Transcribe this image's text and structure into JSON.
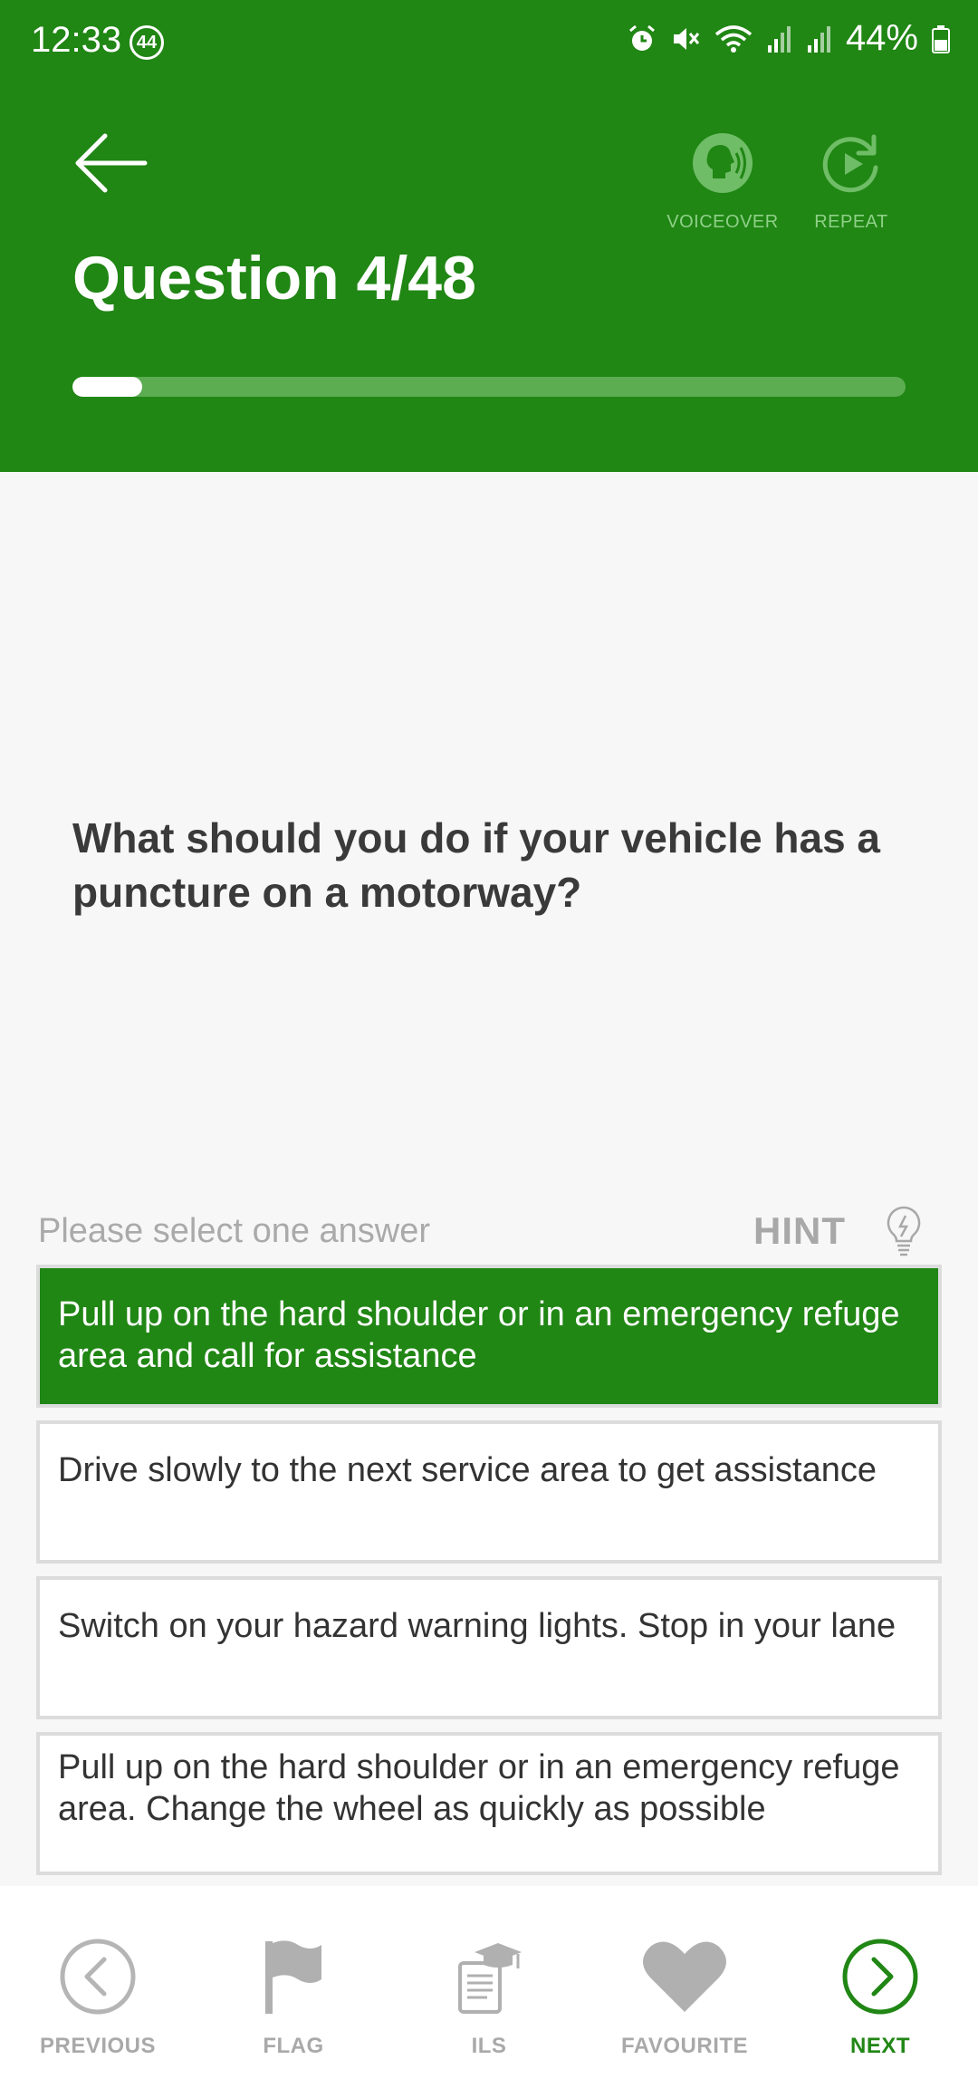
{
  "status_bar": {
    "time": "12:33",
    "notification_count": "44",
    "battery": "44%"
  },
  "header": {
    "title": "Question 4/48",
    "voiceover_label": "VOICEOVER",
    "repeat_label": "REPEAT",
    "progress_fraction": 0.0833
  },
  "question": {
    "text": "What should you do if your vehicle has a puncture on a motorway?",
    "prompt": "Please select one answer",
    "hint_label": "HINT"
  },
  "answers": [
    {
      "text": "Pull up on the hard shoulder or in an emergency refuge area and call for assistance",
      "selected": true
    },
    {
      "text": "Drive slowly to the next service area to get assistance",
      "selected": false
    },
    {
      "text": "Switch on your hazard warning lights. Stop in your lane",
      "selected": false
    },
    {
      "text": "Pull up on the hard shoulder or in an emergency refuge area. Change the wheel as quickly as possible",
      "selected": false
    }
  ],
  "bottom_nav": {
    "previous": "PREVIOUS",
    "flag": "FLAG",
    "ils": "ILS",
    "favourite": "FAVOURITE",
    "next": "NEXT"
  },
  "colors": {
    "primary_green": "#208614",
    "progress_track": "#5cac52",
    "inactive_gray": "#a9a9a9"
  }
}
